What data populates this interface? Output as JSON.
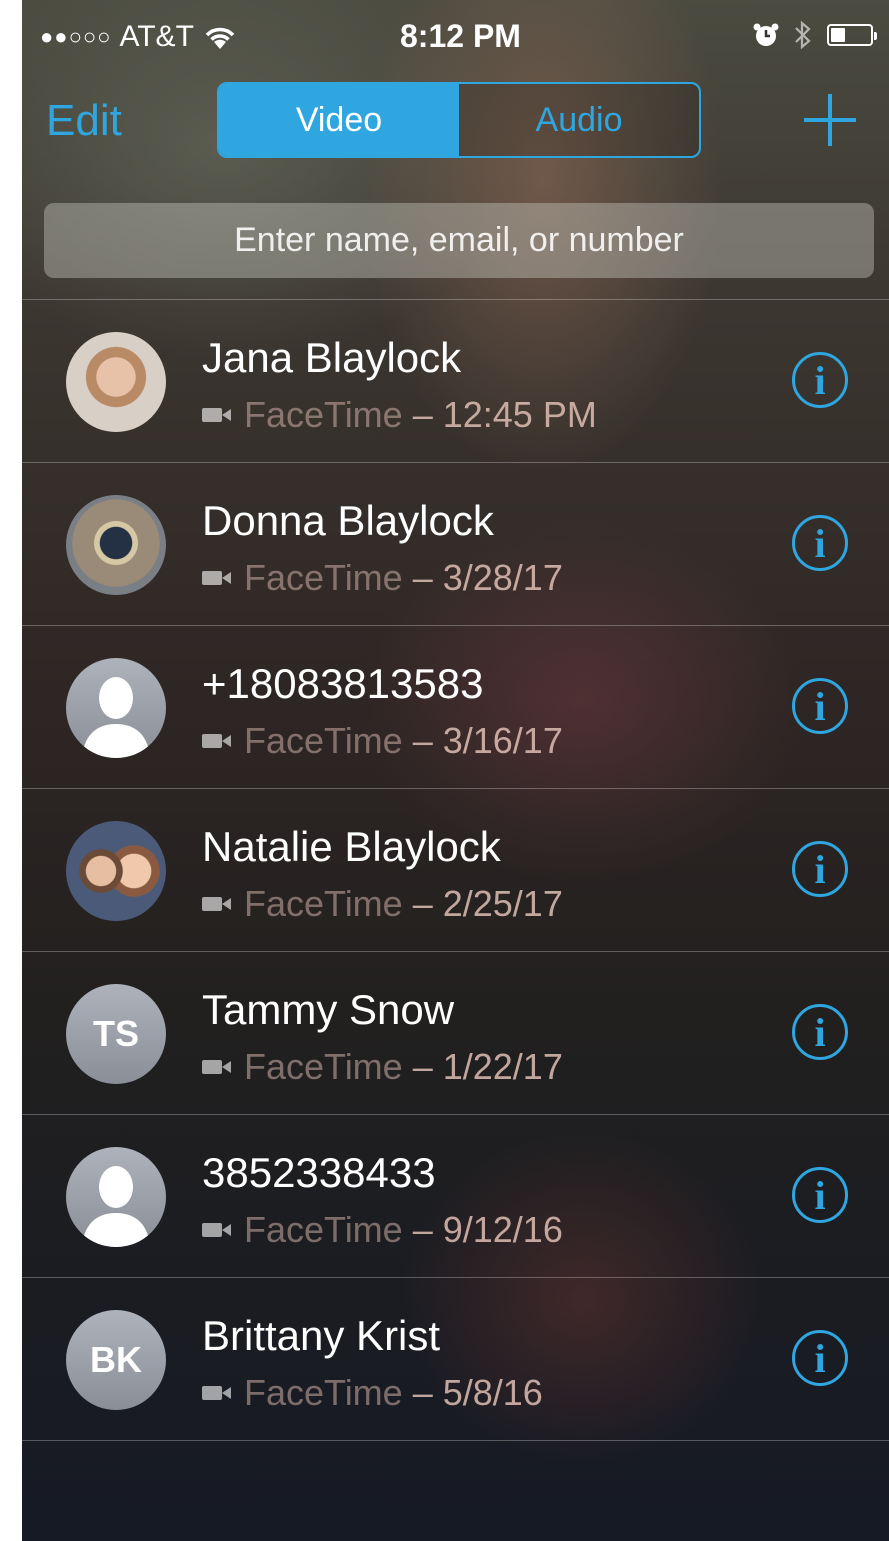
{
  "status_bar": {
    "signal": "●●○○○",
    "carrier": "AT&T",
    "time": "8:12 PM",
    "alarm_icon": "alarm-clock-icon",
    "bluetooth_icon": "bluetooth-icon",
    "battery_icon": "battery-icon",
    "battery_level": 0.3
  },
  "nav": {
    "edit_label": "Edit",
    "segments": [
      "Video",
      "Audio"
    ],
    "selected_segment": "Video",
    "add_icon": "plus-icon"
  },
  "search": {
    "placeholder": "Enter name, email, or number"
  },
  "colors": {
    "accent": "#2fa6df"
  },
  "recents": [
    {
      "name": "Jana Blaylock",
      "service": "FaceTime",
      "time": "– 12:45 PM",
      "avatar": "photo"
    },
    {
      "name": "Donna Blaylock",
      "service": "FaceTime",
      "time": "– 3/28/17",
      "avatar": "photo"
    },
    {
      "name": "+18083813583",
      "service": "FaceTime",
      "time": "– 3/16/17",
      "avatar": "silhouette"
    },
    {
      "name": "Natalie Blaylock",
      "service": "FaceTime",
      "time": "– 2/25/17",
      "avatar": "photo"
    },
    {
      "name": "Tammy Snow",
      "service": "FaceTime",
      "time": "– 1/22/17",
      "avatar": "initials",
      "initials": "TS"
    },
    {
      "name": "3852338433",
      "service": "FaceTime",
      "time": "– 9/12/16",
      "avatar": "silhouette"
    },
    {
      "name": "Brittany Krist",
      "service": "FaceTime",
      "time": "– 5/8/16",
      "avatar": "initials",
      "initials": "BK"
    }
  ]
}
